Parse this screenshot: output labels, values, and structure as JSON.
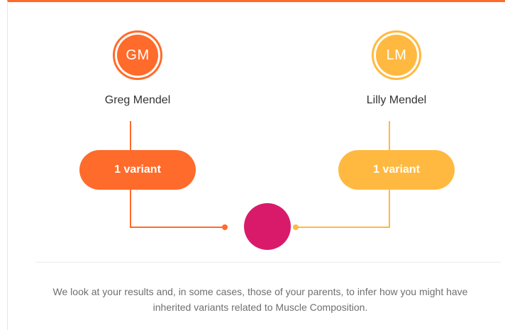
{
  "parents": [
    {
      "initials": "GM",
      "name": "Greg Mendel",
      "variants": "1 variant",
      "color": "#ff6b2b"
    },
    {
      "initials": "LM",
      "name": "Lilly Mendel",
      "variants": "1 variant",
      "color": "#ffb940"
    }
  ],
  "child": {
    "color": "#d91a6a"
  },
  "accent_bar_color": "#ff6b2b",
  "footnote": "We look at your results and, in some cases, those of your parents, to infer how you might have inherited variants related to Muscle Composition."
}
